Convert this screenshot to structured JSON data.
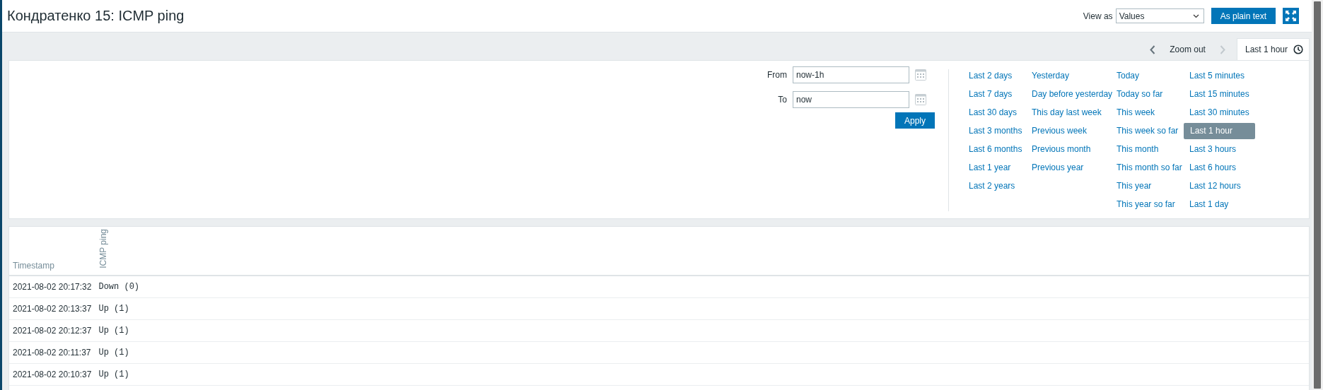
{
  "header": {
    "title": "Кондратенко 15: ICMP ping",
    "view_as_label": "View as",
    "view_as": {
      "value": "Values"
    },
    "plain_text_button": "As plain text"
  },
  "timebar": {
    "zoom_out": "Zoom out",
    "prev_disabled": false,
    "next_disabled": true,
    "tab": {
      "label": "Last 1 hour",
      "selected": true
    }
  },
  "filter": {
    "from": {
      "label": "From",
      "value": "now-1h"
    },
    "to": {
      "label": "To",
      "value": "now"
    },
    "apply": "Apply",
    "quick_ranges": [
      {
        "items": [
          {
            "label": "Last 2 days",
            "selected": false
          },
          {
            "label": "Last 7 days",
            "selected": false
          },
          {
            "label": "Last 30 days",
            "selected": false
          },
          {
            "label": "Last 3 months",
            "selected": false
          },
          {
            "label": "Last 6 months",
            "selected": false
          },
          {
            "label": "Last 1 year",
            "selected": false
          },
          {
            "label": "Last 2 years",
            "selected": false
          }
        ]
      },
      {
        "items": [
          {
            "label": "Yesterday",
            "selected": false
          },
          {
            "label": "Day before yesterday",
            "selected": false
          },
          {
            "label": "This day last week",
            "selected": false
          },
          {
            "label": "Previous week",
            "selected": false
          },
          {
            "label": "Previous month",
            "selected": false
          },
          {
            "label": "Previous year",
            "selected": false
          }
        ]
      },
      {
        "items": [
          {
            "label": "Today",
            "selected": false
          },
          {
            "label": "Today so far",
            "selected": false
          },
          {
            "label": "This week",
            "selected": false
          },
          {
            "label": "This week so far",
            "selected": false
          },
          {
            "label": "This month",
            "selected": false
          },
          {
            "label": "This month so far",
            "selected": false
          },
          {
            "label": "This year",
            "selected": false
          },
          {
            "label": "This year so far",
            "selected": false
          }
        ]
      },
      {
        "items": [
          {
            "label": "Last 5 minutes",
            "selected": false
          },
          {
            "label": "Last 15 minutes",
            "selected": false
          },
          {
            "label": "Last 30 minutes",
            "selected": false
          },
          {
            "label": "Last 1 hour",
            "selected": true
          },
          {
            "label": "Last 3 hours",
            "selected": false
          },
          {
            "label": "Last 6 hours",
            "selected": false
          },
          {
            "label": "Last 12 hours",
            "selected": false
          },
          {
            "label": "Last 1 day",
            "selected": false
          }
        ]
      }
    ]
  },
  "table": {
    "columns": [
      "Timestamp",
      "ICMP ping"
    ],
    "rows": [
      [
        "2021-08-02 20:17:32",
        "Down (0)"
      ],
      [
        "2021-08-02 20:13:37",
        "Up (1)"
      ],
      [
        "2021-08-02 20:12:37",
        "Up (1)"
      ],
      [
        "2021-08-02 20:11:37",
        "Up (1)"
      ],
      [
        "2021-08-02 20:10:37",
        "Up (1)"
      ]
    ]
  }
}
